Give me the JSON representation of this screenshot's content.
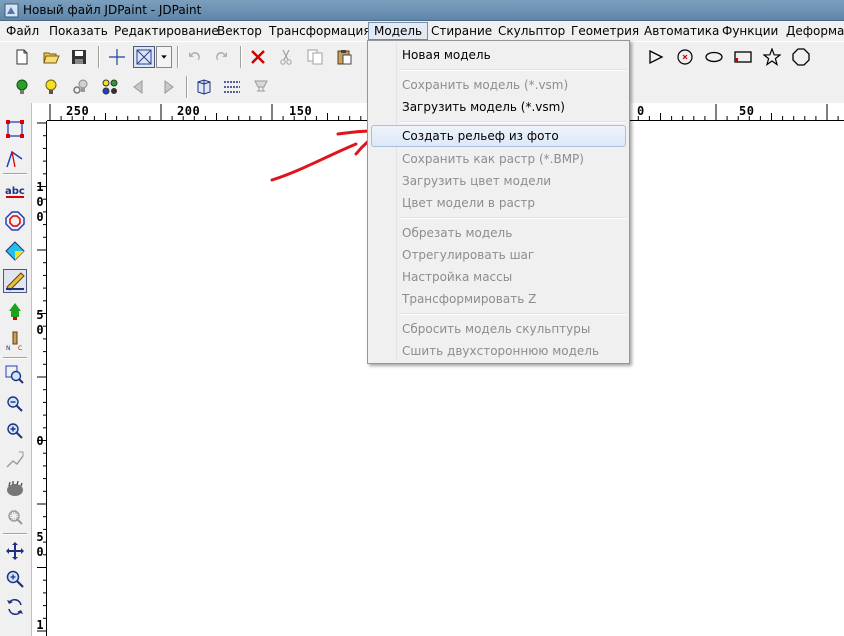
{
  "window": {
    "title": "Новый файл JDPaint - JDPaint"
  },
  "menubar": {
    "items": [
      {
        "label": "Файл"
      },
      {
        "label": "Показать"
      },
      {
        "label": "Редактирование"
      },
      {
        "label": "Вектор"
      },
      {
        "label": "Трансформация"
      },
      {
        "label": "Модель",
        "active": true
      },
      {
        "label": "Стирание"
      },
      {
        "label": "Скульптор"
      },
      {
        "label": "Геометрия"
      },
      {
        "label": "Автоматика"
      },
      {
        "label": "Функции"
      },
      {
        "label": "Деформаци"
      }
    ]
  },
  "ruler": {
    "top_labels": [
      "250",
      "200",
      "150",
      "0",
      "50"
    ],
    "left_labels": [
      [
        "1",
        "0",
        "0"
      ],
      [
        "5",
        "0"
      ],
      [
        "0"
      ],
      [
        "5",
        "0"
      ],
      [
        "1"
      ]
    ]
  },
  "model_menu": {
    "items": [
      {
        "label": "Новая модель",
        "disabled": false
      },
      {
        "label": "Сохранить модель (*.vsm)",
        "disabled": true
      },
      {
        "label": "Загрузить модель (*.vsm)",
        "disabled": false
      },
      {
        "label": "Создать рельеф из фото",
        "disabled": false,
        "highlighted": true
      },
      {
        "label": "Сохранить как растр (*.BMP)",
        "disabled": true
      },
      {
        "label": "Загрузить цвет модели",
        "disabled": true
      },
      {
        "label": "Цвет модели в растр",
        "disabled": true
      },
      {
        "label": "Обрезать модель",
        "disabled": true
      },
      {
        "label": "Отрегулировать шаг",
        "disabled": true
      },
      {
        "label": "Настройка массы",
        "disabled": true
      },
      {
        "label": "Трансформировать Z",
        "disabled": true
      },
      {
        "label": "Сбросить модель скульптуры",
        "disabled": true
      },
      {
        "label": "Сшить двухстороннюю модель",
        "disabled": true
      }
    ]
  },
  "annotation": {
    "arrow_color": "#e0141e"
  },
  "colors": {
    "menu_bg": "#f0f0f0",
    "disabled_text": "#8d8d8d",
    "highlight_border": "#a8c0e0"
  }
}
